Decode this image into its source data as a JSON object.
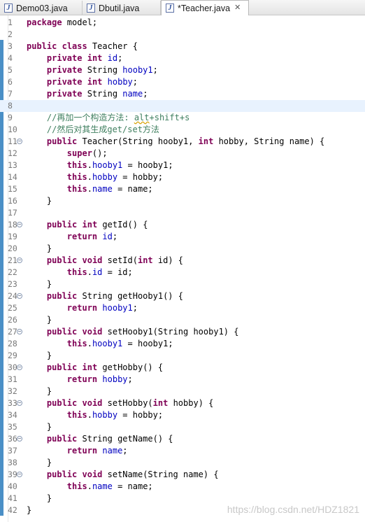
{
  "tabs": [
    {
      "label": "Demo03.java",
      "active": false
    },
    {
      "label": "Dbutil.java",
      "active": false
    },
    {
      "label": "*Teacher.java",
      "active": true
    }
  ],
  "tab_icon": "java-file-icon",
  "close_icon": "close-tab-icon",
  "current_line": 8,
  "lines": [
    {
      "n": "1",
      "tokens": [
        [
          "kw",
          "package"
        ],
        [
          "p",
          " model;"
        ]
      ]
    },
    {
      "n": "2",
      "tokens": []
    },
    {
      "n": "3",
      "tokens": [
        [
          "kw",
          "public"
        ],
        [
          "p",
          " "
        ],
        [
          "kw",
          "class"
        ],
        [
          "p",
          " Teacher {"
        ]
      ]
    },
    {
      "n": "4",
      "tokens": [
        [
          "p",
          "    "
        ],
        [
          "kw",
          "private"
        ],
        [
          "p",
          " "
        ],
        [
          "kw",
          "int"
        ],
        [
          "p",
          " "
        ],
        [
          "fld",
          "id"
        ],
        [
          "p",
          ";"
        ]
      ]
    },
    {
      "n": "5",
      "tokens": [
        [
          "p",
          "    "
        ],
        [
          "kw",
          "private"
        ],
        [
          "p",
          " String "
        ],
        [
          "fld",
          "hooby1"
        ],
        [
          "p",
          ";"
        ]
      ]
    },
    {
      "n": "6",
      "tokens": [
        [
          "p",
          "    "
        ],
        [
          "kw",
          "private"
        ],
        [
          "p",
          " "
        ],
        [
          "kw",
          "int"
        ],
        [
          "p",
          " "
        ],
        [
          "fld",
          "hobby"
        ],
        [
          "p",
          ";"
        ]
      ]
    },
    {
      "n": "7",
      "tokens": [
        [
          "p",
          "    "
        ],
        [
          "kw",
          "private"
        ],
        [
          "p",
          " String "
        ],
        [
          "fld",
          "name"
        ],
        [
          "p",
          ";"
        ]
      ]
    },
    {
      "n": "8",
      "tokens": []
    },
    {
      "n": "9",
      "tokens": [
        [
          "p",
          "    "
        ],
        [
          "cmt",
          "//再加一个构造方法: "
        ],
        [
          "cmtsq",
          "alt"
        ],
        [
          "cmt",
          "+shift+s"
        ]
      ]
    },
    {
      "n": "10",
      "tokens": [
        [
          "p",
          "    "
        ],
        [
          "cmt",
          "//然后对其生成get/set方法"
        ]
      ]
    },
    {
      "n": "11",
      "fold": true,
      "tokens": [
        [
          "p",
          "    "
        ],
        [
          "kw",
          "public"
        ],
        [
          "p",
          " Teacher(String hooby1, "
        ],
        [
          "kw",
          "int"
        ],
        [
          "p",
          " hobby, String name) {"
        ]
      ]
    },
    {
      "n": "12",
      "tokens": [
        [
          "p",
          "        "
        ],
        [
          "kw",
          "super"
        ],
        [
          "p",
          "();"
        ]
      ]
    },
    {
      "n": "13",
      "tokens": [
        [
          "p",
          "        "
        ],
        [
          "kw",
          "this"
        ],
        [
          "p",
          "."
        ],
        [
          "fld",
          "hooby1"
        ],
        [
          "p",
          " = hooby1;"
        ]
      ]
    },
    {
      "n": "14",
      "tokens": [
        [
          "p",
          "        "
        ],
        [
          "kw",
          "this"
        ],
        [
          "p",
          "."
        ],
        [
          "fld",
          "hobby"
        ],
        [
          "p",
          " = hobby;"
        ]
      ]
    },
    {
      "n": "15",
      "tokens": [
        [
          "p",
          "        "
        ],
        [
          "kw",
          "this"
        ],
        [
          "p",
          "."
        ],
        [
          "fld",
          "name"
        ],
        [
          "p",
          " = name;"
        ]
      ]
    },
    {
      "n": "16",
      "tokens": [
        [
          "p",
          "    }"
        ]
      ]
    },
    {
      "n": "17",
      "tokens": []
    },
    {
      "n": "18",
      "fold": true,
      "tokens": [
        [
          "p",
          "    "
        ],
        [
          "kw",
          "public"
        ],
        [
          "p",
          " "
        ],
        [
          "kw",
          "int"
        ],
        [
          "p",
          " getId() {"
        ]
      ]
    },
    {
      "n": "19",
      "tokens": [
        [
          "p",
          "        "
        ],
        [
          "kw",
          "return"
        ],
        [
          "p",
          " "
        ],
        [
          "fld",
          "id"
        ],
        [
          "p",
          ";"
        ]
      ]
    },
    {
      "n": "20",
      "tokens": [
        [
          "p",
          "    }"
        ]
      ]
    },
    {
      "n": "21",
      "fold": true,
      "tokens": [
        [
          "p",
          "    "
        ],
        [
          "kw",
          "public"
        ],
        [
          "p",
          " "
        ],
        [
          "kw",
          "void"
        ],
        [
          "p",
          " setId("
        ],
        [
          "kw",
          "int"
        ],
        [
          "p",
          " id) {"
        ]
      ]
    },
    {
      "n": "22",
      "tokens": [
        [
          "p",
          "        "
        ],
        [
          "kw",
          "this"
        ],
        [
          "p",
          "."
        ],
        [
          "fld",
          "id"
        ],
        [
          "p",
          " = id;"
        ]
      ]
    },
    {
      "n": "23",
      "tokens": [
        [
          "p",
          "    }"
        ]
      ]
    },
    {
      "n": "24",
      "fold": true,
      "tokens": [
        [
          "p",
          "    "
        ],
        [
          "kw",
          "public"
        ],
        [
          "p",
          " String getHooby1() {"
        ]
      ]
    },
    {
      "n": "25",
      "tokens": [
        [
          "p",
          "        "
        ],
        [
          "kw",
          "return"
        ],
        [
          "p",
          " "
        ],
        [
          "fld",
          "hooby1"
        ],
        [
          "p",
          ";"
        ]
      ]
    },
    {
      "n": "26",
      "tokens": [
        [
          "p",
          "    }"
        ]
      ]
    },
    {
      "n": "27",
      "fold": true,
      "tokens": [
        [
          "p",
          "    "
        ],
        [
          "kw",
          "public"
        ],
        [
          "p",
          " "
        ],
        [
          "kw",
          "void"
        ],
        [
          "p",
          " setHooby1(String hooby1) {"
        ]
      ]
    },
    {
      "n": "28",
      "tokens": [
        [
          "p",
          "        "
        ],
        [
          "kw",
          "this"
        ],
        [
          "p",
          "."
        ],
        [
          "fld",
          "hooby1"
        ],
        [
          "p",
          " = hooby1;"
        ]
      ]
    },
    {
      "n": "29",
      "tokens": [
        [
          "p",
          "    }"
        ]
      ]
    },
    {
      "n": "30",
      "fold": true,
      "tokens": [
        [
          "p",
          "    "
        ],
        [
          "kw",
          "public"
        ],
        [
          "p",
          " "
        ],
        [
          "kw",
          "int"
        ],
        [
          "p",
          " getHobby() {"
        ]
      ]
    },
    {
      "n": "31",
      "tokens": [
        [
          "p",
          "        "
        ],
        [
          "kw",
          "return"
        ],
        [
          "p",
          " "
        ],
        [
          "fld",
          "hobby"
        ],
        [
          "p",
          ";"
        ]
      ]
    },
    {
      "n": "32",
      "tokens": [
        [
          "p",
          "    }"
        ]
      ]
    },
    {
      "n": "33",
      "fold": true,
      "tokens": [
        [
          "p",
          "    "
        ],
        [
          "kw",
          "public"
        ],
        [
          "p",
          " "
        ],
        [
          "kw",
          "void"
        ],
        [
          "p",
          " setHobby("
        ],
        [
          "kw",
          "int"
        ],
        [
          "p",
          " hobby) {"
        ]
      ]
    },
    {
      "n": "34",
      "tokens": [
        [
          "p",
          "        "
        ],
        [
          "kw",
          "this"
        ],
        [
          "p",
          "."
        ],
        [
          "fld",
          "hobby"
        ],
        [
          "p",
          " = hobby;"
        ]
      ]
    },
    {
      "n": "35",
      "tokens": [
        [
          "p",
          "    }"
        ]
      ]
    },
    {
      "n": "36",
      "fold": true,
      "tokens": [
        [
          "p",
          "    "
        ],
        [
          "kw",
          "public"
        ],
        [
          "p",
          " String getName() {"
        ]
      ]
    },
    {
      "n": "37",
      "tokens": [
        [
          "p",
          "        "
        ],
        [
          "kw",
          "return"
        ],
        [
          "p",
          " "
        ],
        [
          "fld",
          "name"
        ],
        [
          "p",
          ";"
        ]
      ]
    },
    {
      "n": "38",
      "tokens": [
        [
          "p",
          "    }"
        ]
      ]
    },
    {
      "n": "39",
      "fold": true,
      "tokens": [
        [
          "p",
          "    "
        ],
        [
          "kw",
          "public"
        ],
        [
          "p",
          " "
        ],
        [
          "kw",
          "void"
        ],
        [
          "p",
          " setName(String name) {"
        ]
      ]
    },
    {
      "n": "40",
      "tokens": [
        [
          "p",
          "        "
        ],
        [
          "kw",
          "this"
        ],
        [
          "p",
          "."
        ],
        [
          "fld",
          "name"
        ],
        [
          "p",
          " = name;"
        ]
      ]
    },
    {
      "n": "41",
      "tokens": [
        [
          "p",
          "    }"
        ]
      ]
    },
    {
      "n": "42",
      "tokens": [
        [
          "p",
          "}"
        ]
      ]
    }
  ],
  "watermark": "https://blog.csdn.net/HDZ1821",
  "colors": {
    "keyword": "#7f0055",
    "field": "#0000c0",
    "comment": "#3f7f5f",
    "current_line": "#e8f2fe",
    "change_bar": "#4a8fc6"
  }
}
